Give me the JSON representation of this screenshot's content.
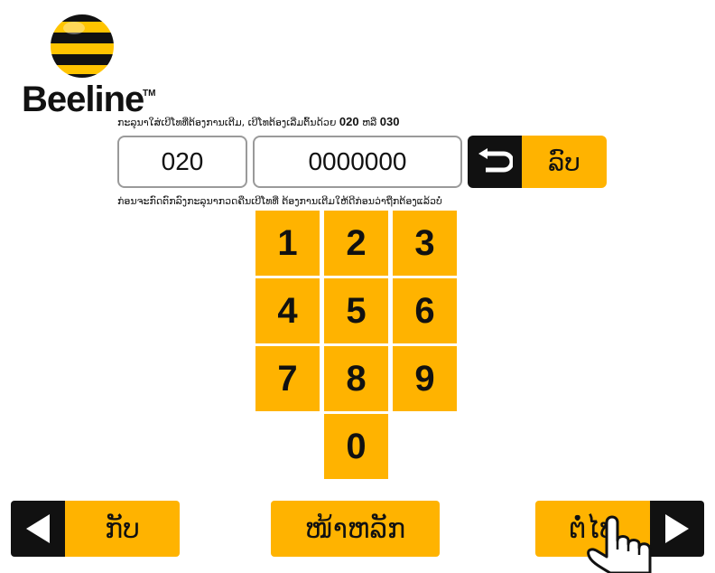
{
  "brand": {
    "name": "Beeline",
    "tm": "TM"
  },
  "instruction": {
    "text": "ກະລຸນາໃສ່ເບີໂທທີ່ຕ້ອງການເຕີມ, ເບີໂທຕ້ອງເລີ່ມຕົ້ນດ້ວຍ ",
    "prefix_a": "020",
    "or": " ຫລື ",
    "prefix_b": "030"
  },
  "phone": {
    "prefix": "020",
    "number": "0000000"
  },
  "delete_button": {
    "label": "ລົບ",
    "icon": "backspace-return-icon"
  },
  "hint": "ກ່ອນຈະກົດຕົກລົງກະລຸນາກວດຄືນເບີໂທທີ່ ຕ້ອງການເຕີມໃຫ້ດີກ່ອນວ່າຖືກຕ້ອງແລ້ວບໍ່",
  "keypad": [
    "1",
    "2",
    "3",
    "4",
    "5",
    "6",
    "7",
    "8",
    "9",
    "0"
  ],
  "nav": {
    "back_label": "ກັບ",
    "home_label": "ໜ້າຫລັກ",
    "next_label": "ຕໍ່ໄປ"
  },
  "colors": {
    "accent": "#ffb300",
    "dark": "#111111",
    "field_border": "#9a9a9a"
  }
}
